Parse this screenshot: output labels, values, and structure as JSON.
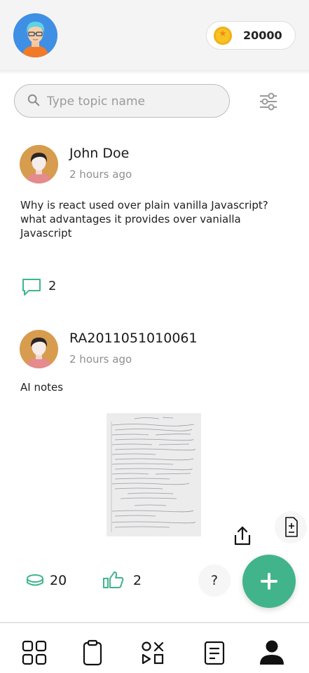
{
  "header": {
    "coins": "20000",
    "avatar_icon": "user-avatar-icon",
    "coin_icon": "star-coin-icon"
  },
  "search": {
    "placeholder": "Type topic name",
    "filter_icon": "sliders-icon"
  },
  "posts": [
    {
      "author": "John Doe",
      "time": "2 hours ago",
      "body": "Why is react used over plain vanilla Javascript? what advantages it provides over vanialla Javascript",
      "comments": "2"
    },
    {
      "author": "RA2011051010061",
      "time": "2 hours ago",
      "body": "AI notes",
      "coins": "20",
      "likes": "2"
    }
  ],
  "actions": {
    "help_label": "?"
  },
  "nav": {
    "items": [
      "grid-icon",
      "clipboard-icon",
      "shapes-icon",
      "notes-icon",
      "profile-icon"
    ]
  },
  "colors": {
    "accent": "#42b48c",
    "header_bg": "#f4f4f4"
  }
}
